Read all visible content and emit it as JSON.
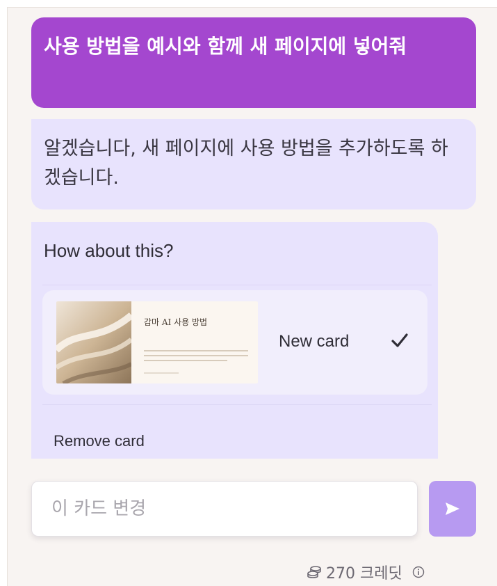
{
  "chat": {
    "user_message": "사용 방법을 예시와 함께 새 페이지에 넣어줘",
    "assistant_message": "알겠습니다, 새 페이지에 사용 방법을 추가하도록 하겠습니다."
  },
  "suggestion": {
    "title": "How about this?",
    "card_option": {
      "thumbnail_title": "감마 AI 사용 방법",
      "label": "New card",
      "selected": true
    },
    "remove_label": "Remove card"
  },
  "composer": {
    "placeholder": "이 카드 변경"
  },
  "credits": {
    "text": "270 크레딧"
  },
  "icons": {
    "send": "send-icon",
    "check": "check-icon",
    "credits": "coins-icon",
    "info": "info-icon"
  },
  "colors": {
    "user_bubble": "#a447cf",
    "assistant_bubble": "#e8e3fd",
    "send_button": "#b79af1",
    "panel_bg": "#f8f4f2"
  }
}
